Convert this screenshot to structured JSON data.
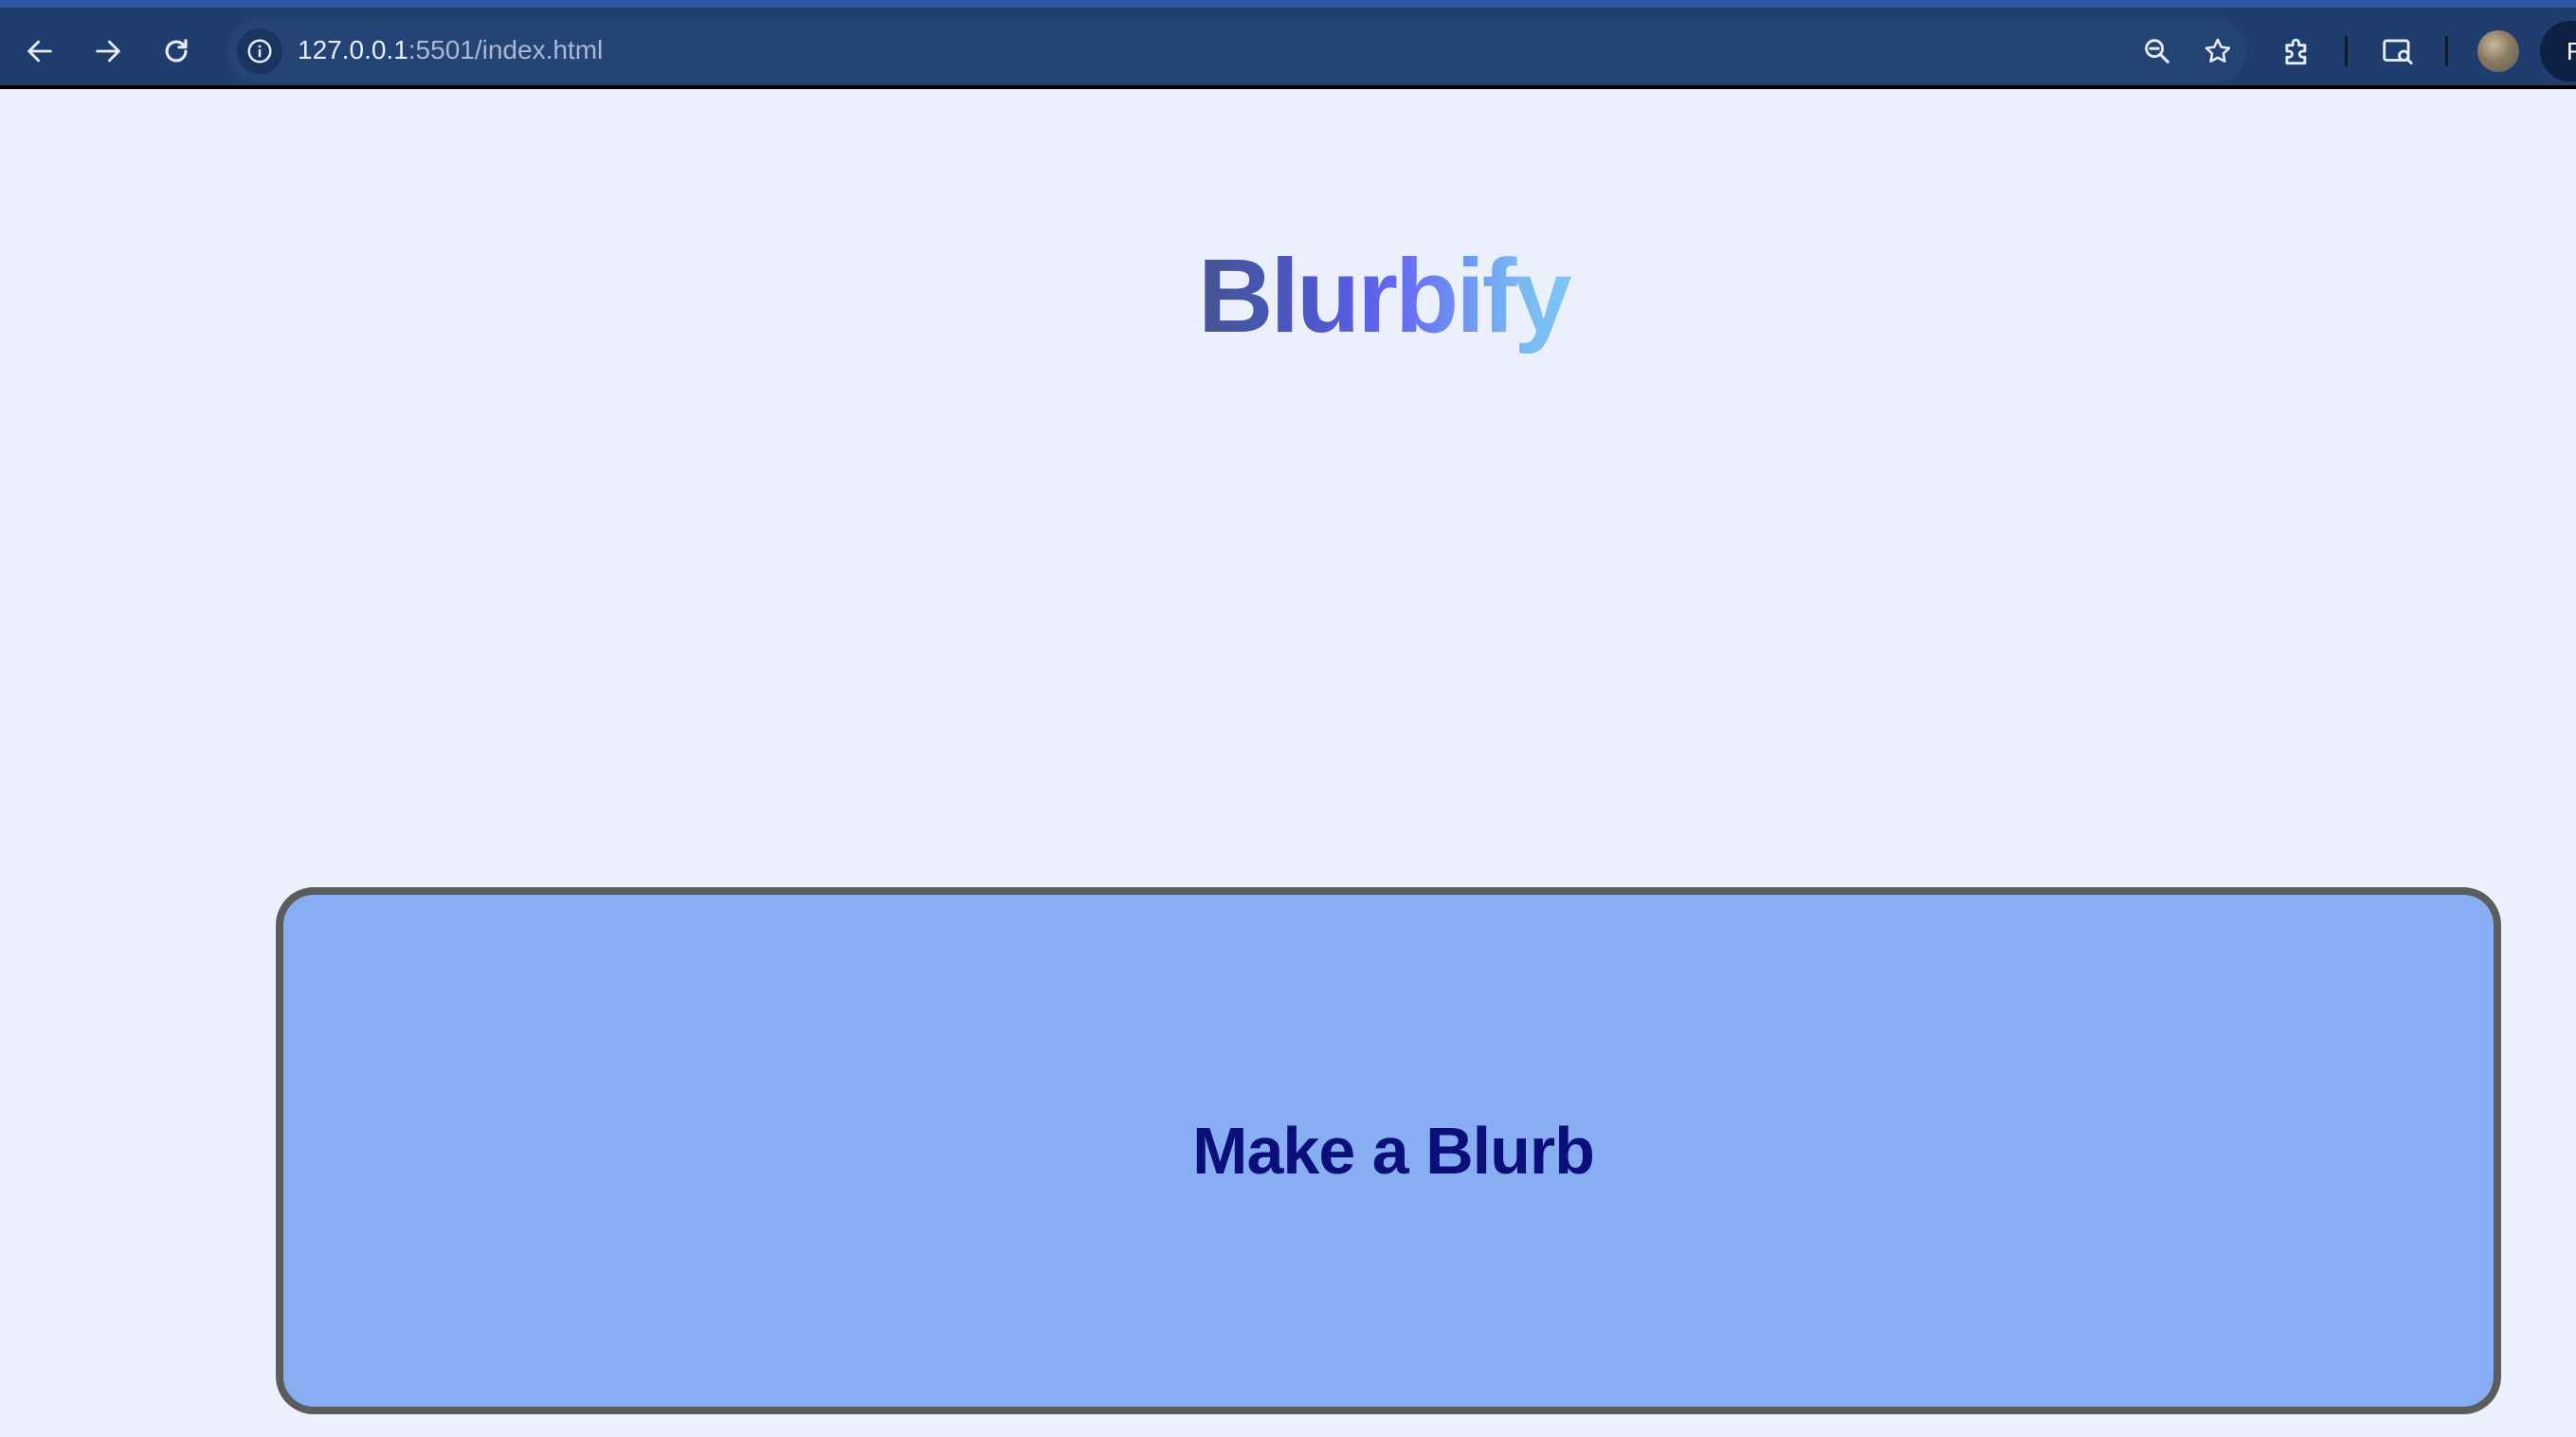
{
  "browser": {
    "url_host": "127.0.0.1",
    "url_rest": ":5501/index.html",
    "profile_initial": "F",
    "icons": {
      "back": "arrow-left-icon",
      "forward": "arrow-right-icon",
      "reload": "reload-icon",
      "site_info": "info-icon",
      "zoom": "zoom-out-icon",
      "bookmark": "star-icon",
      "extensions": "puzzle-icon",
      "search_tab": "tab-search-icon"
    }
  },
  "page": {
    "title": "Blurbify",
    "primary_button": "Make a Blurb"
  },
  "colors": {
    "page_background": "#ecf0fd",
    "button_fill": "#88adf2",
    "button_border": "#5c5c5c",
    "button_text": "#0a0f7a",
    "logo_gradient": [
      "#44548f",
      "#6366f1",
      "#7ec6f5"
    ]
  }
}
